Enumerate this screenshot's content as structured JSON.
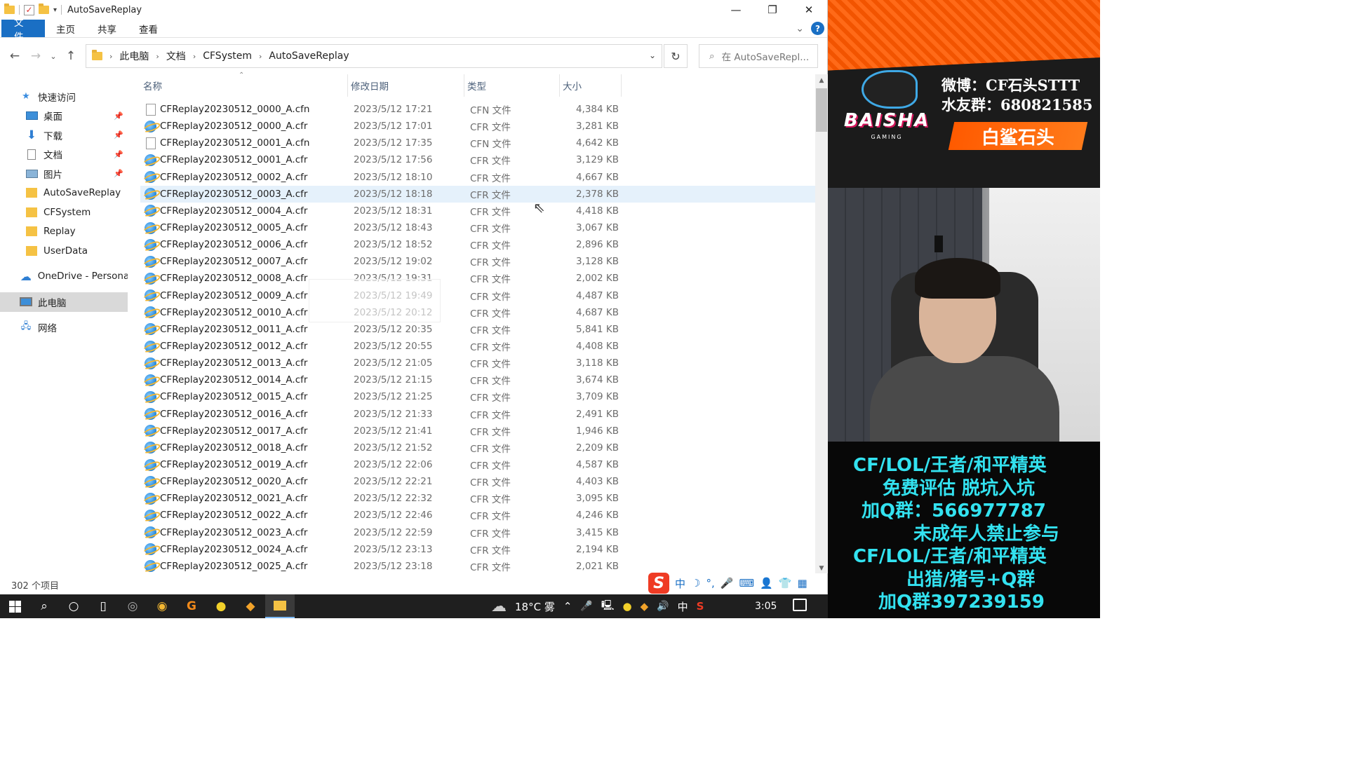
{
  "window": {
    "title": "AutoSaveReplay",
    "controls": {
      "minimize": "—",
      "restore": "❐",
      "close": "✕"
    }
  },
  "ribbon": {
    "tabs": [
      "文件",
      "主页",
      "共享",
      "查看"
    ],
    "expand": "⌄",
    "help": "?"
  },
  "address": {
    "crumbs": [
      "此电脑",
      "文档",
      "CFSystem",
      "AutoSaveReplay"
    ],
    "search_placeholder": "在 AutoSaveRepl..."
  },
  "navpane": {
    "quick_access": "快速访问",
    "pinned": [
      "桌面",
      "下载",
      "文档",
      "图片"
    ],
    "folders": [
      "AutoSaveReplay",
      "CFSystem",
      "Replay",
      "UserData"
    ],
    "onedrive": "OneDrive - Persona",
    "this_pc": "此电脑",
    "network": "网络"
  },
  "columns": {
    "name": "名称",
    "date": "修改日期",
    "type": "类型",
    "size": "大小"
  },
  "files": [
    {
      "name": "CFReplay20230512_0000_A.cfn",
      "date": "2023/5/12 17:21",
      "type": "CFN 文件",
      "size": "4,384 KB",
      "icon": "doc"
    },
    {
      "name": "CFReplay20230512_0000_A.cfr",
      "date": "2023/5/12 17:01",
      "type": "CFR 文件",
      "size": "3,281 KB",
      "icon": "ie"
    },
    {
      "name": "CFReplay20230512_0001_A.cfn",
      "date": "2023/5/12 17:35",
      "type": "CFN 文件",
      "size": "4,642 KB",
      "icon": "doc"
    },
    {
      "name": "CFReplay20230512_0001_A.cfr",
      "date": "2023/5/12 17:56",
      "type": "CFR 文件",
      "size": "3,129 KB",
      "icon": "ie"
    },
    {
      "name": "CFReplay20230512_0002_A.cfr",
      "date": "2023/5/12 18:10",
      "type": "CFR 文件",
      "size": "4,667 KB",
      "icon": "ie"
    },
    {
      "name": "CFReplay20230512_0003_A.cfr",
      "date": "2023/5/12 18:18",
      "type": "CFR 文件",
      "size": "2,378 KB",
      "icon": "ie",
      "selected": true
    },
    {
      "name": "CFReplay20230512_0004_A.cfr",
      "date": "2023/5/12 18:31",
      "type": "CFR 文件",
      "size": "4,418 KB",
      "icon": "ie"
    },
    {
      "name": "CFReplay20230512_0005_A.cfr",
      "date": "2023/5/12 18:43",
      "type": "CFR 文件",
      "size": "3,067 KB",
      "icon": "ie"
    },
    {
      "name": "CFReplay20230512_0006_A.cfr",
      "date": "2023/5/12 18:52",
      "type": "CFR 文件",
      "size": "2,896 KB",
      "icon": "ie"
    },
    {
      "name": "CFReplay20230512_0007_A.cfr",
      "date": "2023/5/12 19:02",
      "type": "CFR 文件",
      "size": "3,128 KB",
      "icon": "ie"
    },
    {
      "name": "CFReplay20230512_0008_A.cfr",
      "date": "2023/5/12 19:31",
      "type": "CFR 文件",
      "size": "2,002 KB",
      "icon": "ie"
    },
    {
      "name": "CFReplay20230512_0009_A.cfr",
      "date": "2023/5/12 19:49",
      "type": "CFR 文件",
      "size": "4,487 KB",
      "icon": "ie"
    },
    {
      "name": "CFReplay20230512_0010_A.cfr",
      "date": "2023/5/12 20:12",
      "type": "CFR 文件",
      "size": "4,687 KB",
      "icon": "ie"
    },
    {
      "name": "CFReplay20230512_0011_A.cfr",
      "date": "2023/5/12 20:35",
      "type": "CFR 文件",
      "size": "5,841 KB",
      "icon": "ie"
    },
    {
      "name": "CFReplay20230512_0012_A.cfr",
      "date": "2023/5/12 20:55",
      "type": "CFR 文件",
      "size": "4,408 KB",
      "icon": "ie"
    },
    {
      "name": "CFReplay20230512_0013_A.cfr",
      "date": "2023/5/12 21:05",
      "type": "CFR 文件",
      "size": "3,118 KB",
      "icon": "ie"
    },
    {
      "name": "CFReplay20230512_0014_A.cfr",
      "date": "2023/5/12 21:15",
      "type": "CFR 文件",
      "size": "3,674 KB",
      "icon": "ie"
    },
    {
      "name": "CFReplay20230512_0015_A.cfr",
      "date": "2023/5/12 21:25",
      "type": "CFR 文件",
      "size": "3,709 KB",
      "icon": "ie"
    },
    {
      "name": "CFReplay20230512_0016_A.cfr",
      "date": "2023/5/12 21:33",
      "type": "CFR 文件",
      "size": "2,491 KB",
      "icon": "ie"
    },
    {
      "name": "CFReplay20230512_0017_A.cfr",
      "date": "2023/5/12 21:41",
      "type": "CFR 文件",
      "size": "1,946 KB",
      "icon": "ie"
    },
    {
      "name": "CFReplay20230512_0018_A.cfr",
      "date": "2023/5/12 21:52",
      "type": "CFR 文件",
      "size": "2,209 KB",
      "icon": "ie"
    },
    {
      "name": "CFReplay20230512_0019_A.cfr",
      "date": "2023/5/12 22:06",
      "type": "CFR 文件",
      "size": "4,587 KB",
      "icon": "ie"
    },
    {
      "name": "CFReplay20230512_0020_A.cfr",
      "date": "2023/5/12 22:21",
      "type": "CFR 文件",
      "size": "4,403 KB",
      "icon": "ie"
    },
    {
      "name": "CFReplay20230512_0021_A.cfr",
      "date": "2023/5/12 22:32",
      "type": "CFR 文件",
      "size": "3,095 KB",
      "icon": "ie"
    },
    {
      "name": "CFReplay20230512_0022_A.cfr",
      "date": "2023/5/12 22:46",
      "type": "CFR 文件",
      "size": "4,246 KB",
      "icon": "ie"
    },
    {
      "name": "CFReplay20230512_0023_A.cfr",
      "date": "2023/5/12 22:59",
      "type": "CFR 文件",
      "size": "3,415 KB",
      "icon": "ie"
    },
    {
      "name": "CFReplay20230512_0024_A.cfr",
      "date": "2023/5/12 23:13",
      "type": "CFR 文件",
      "size": "2,194 KB",
      "icon": "ie"
    },
    {
      "name": "CFReplay20230512_0025_A.cfr",
      "date": "2023/5/12 23:18",
      "type": "CFR 文件",
      "size": "2,021 KB",
      "icon": "ie"
    }
  ],
  "status": {
    "item_count": "302 个项目"
  },
  "ime": {
    "mode": "中",
    "icons": [
      "moon-icon",
      "punctuation-icon",
      "mic-icon",
      "keyboard-icon",
      "user-icon",
      "skin-icon",
      "grid-icon"
    ]
  },
  "taskbar": {
    "weather": "18°C 雾",
    "lang": "中",
    "time": "3:05"
  },
  "overlay": {
    "logo_text": "BAISHA",
    "logo_sub": "GAMING",
    "weibo": "微博：CF石头STTT",
    "fans_group": "水友群：680821585",
    "streamer": "白鲨石头",
    "promo_lines": [
      "CF/LOL/王者/和平精英",
      "免费评估  脱坑入坑",
      "加Q群：566977787",
      "未成年人禁止参与",
      "CF/LOL/王者/和平精英",
      "出猎/猪号+Q群",
      "加Q群397239159"
    ],
    "accent": "#ff5a00",
    "promo_color": "#33e2f0"
  }
}
